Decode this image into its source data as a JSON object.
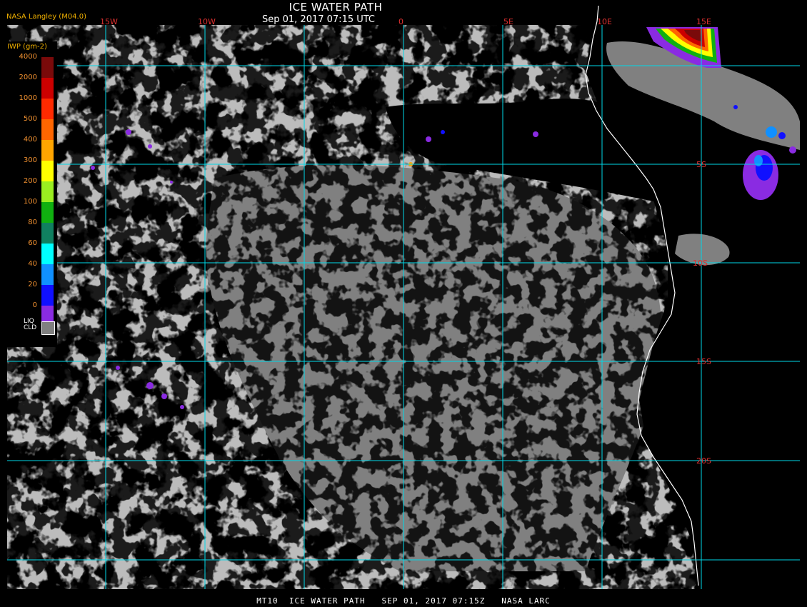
{
  "header": {
    "title": "ICE WATER PATH",
    "datetime": "Sep 01, 2017 07:15 UTC",
    "agency": "NASA Langley (M04.0)"
  },
  "footer": {
    "text": "MT10  ICE WATER PATH   SEP 01, 2017 07:15Z   NASA LARC"
  },
  "grid": {
    "lon_labels": [
      "15W",
      "10W",
      "0",
      "5E",
      "10E",
      "15E"
    ],
    "lat_labels": [
      "5S",
      "10S",
      "15S",
      "20S"
    ],
    "line_color": "#00d8e8",
    "label_color": "#e03030"
  },
  "legend": {
    "title": "IWP (gm-2)",
    "ticks": [
      "4000",
      "2000",
      "1000",
      "500",
      "400",
      "300",
      "200",
      "100",
      "80",
      "60",
      "40",
      "20",
      "0"
    ],
    "colors": [
      "#7a0a0a",
      "#cc0000",
      "#ff2a00",
      "#ff6600",
      "#ffa500",
      "#ffff00",
      "#9aee20",
      "#10b010",
      "#108060",
      "#00ffff",
      "#1090ff",
      "#1010ff",
      "#8a2be2"
    ],
    "liquid_label_line1": "LIQ",
    "liquid_label_line2": "CLD",
    "liquid_color": "#808080"
  },
  "colors": {
    "ocean": "#000000",
    "liquid_cloud": "#808080",
    "coastline": "#ffffff"
  }
}
